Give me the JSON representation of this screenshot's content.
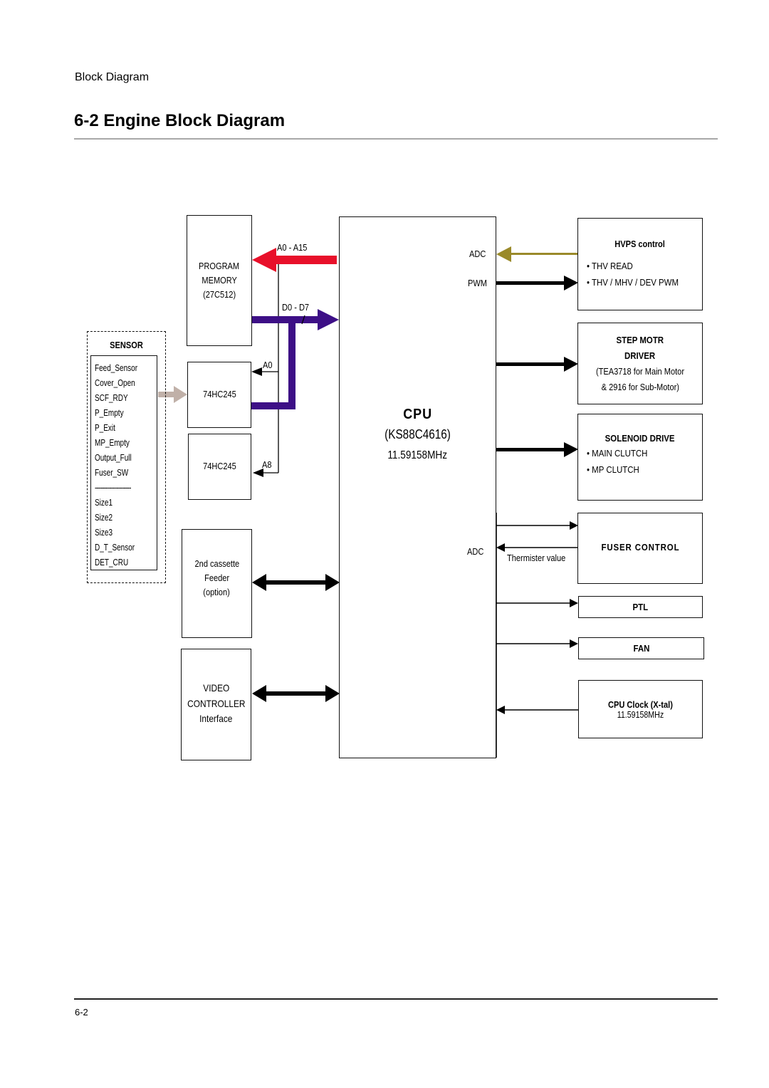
{
  "header": {
    "section_label": "Block Diagram",
    "title": "6-2  Engine Block Diagram"
  },
  "footer": {
    "page_number": "6-2"
  },
  "colors": {
    "address_bus": "#e8102a",
    "data_bus": "#3d0f86",
    "adc_line": "#9a8a2a",
    "sensor_arrow": "#c0b0a8",
    "line": "#000000"
  },
  "program_memory": {
    "lines": [
      "PROGRAM",
      "MEMORY",
      "(27C512)"
    ]
  },
  "buses": {
    "address": "A0  -  A15",
    "data": "D0  -  D7",
    "a0": "A0",
    "a8": "A8"
  },
  "buffer1": {
    "label": "74HC245"
  },
  "buffer2": {
    "label": "74HC245"
  },
  "sensor": {
    "title": "SENSOR",
    "items": [
      "Feed_Sensor",
      "Cover_Open",
      "SCF_RDY",
      "P_Empty",
      "P_Exit",
      "MP_Empty",
      "Output_Full",
      "Fuser_SW"
    ],
    "separator": "--------------------",
    "size_items": [
      "Size1",
      "Size2",
      "Size3",
      "D_T_Sensor",
      "DET_CRU"
    ]
  },
  "cassette": {
    "lines": [
      "2nd  cassette",
      "Feeder",
      "(option)"
    ]
  },
  "video": {
    "lines": [
      "VIDEO",
      "CONTROLLER",
      "Interface"
    ]
  },
  "cpu": {
    "title": "CPU",
    "model": "(KS88C4616)",
    "clock": "11.59158MHz",
    "pins": {
      "adc_top": "ADC",
      "pwm": "PWM",
      "adc_bottom": "ADC"
    }
  },
  "hvps": {
    "title": "HVPS  control",
    "items": [
      "• THV READ",
      "• THV / MHV / DEV PWM"
    ]
  },
  "step_motor": {
    "title_lines": [
      "STEP MOTR",
      "DRIVER"
    ],
    "detail_lines": [
      "(TEA3718 for Main Motor",
      "& 2916 for Sub-Motor)"
    ]
  },
  "solenoid": {
    "title": "SOLENOID  DRIVE",
    "items": [
      "• MAIN CLUTCH",
      "• MP CLUTCH"
    ]
  },
  "fuser": {
    "title": "FUSER  CONTROL",
    "feedback_label": "Thermister value"
  },
  "ptl": {
    "title": "PTL"
  },
  "fan": {
    "title": "FAN"
  },
  "cpu_clock": {
    "title": "CPU Clock (X-tal)",
    "value": "11.59158MHz"
  }
}
